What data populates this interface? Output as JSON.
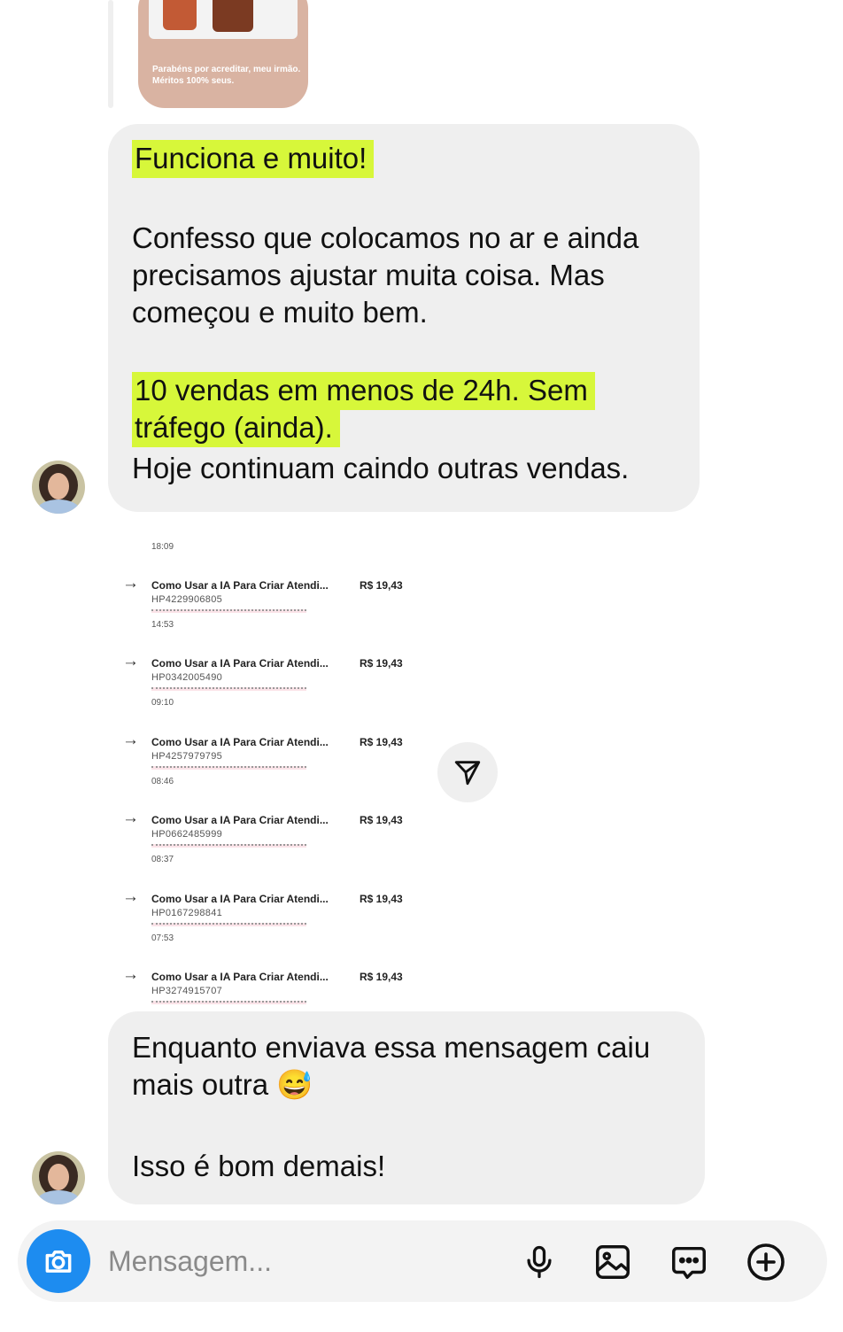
{
  "story_reply": {
    "caption": "Parabéns por acreditar, meu irmão. Méritos 100% seus."
  },
  "messages": [
    {
      "highlight_1": "Funciona e muito!",
      "paragraph": "Confesso que colocamos no ar e ainda precisamos ajustar muita coisa. Mas começou e muito bem.",
      "highlight_2": "10 vendas em menos de 24h. Sem tráfego (ainda).",
      "last_line": "Hoje continuam caindo outras vendas."
    },
    {
      "line_1": "Enquanto enviava essa mensagem caiu mais outra",
      "emoji": "😅",
      "line_2": "Isso é bom demais!"
    }
  ],
  "sales_screenshot": {
    "times": [
      "18:09",
      "14:53",
      "09:10",
      "08:46",
      "08:37",
      "07:53"
    ],
    "rows": [
      {
        "product": "Como Usar a IA Para Criar Atendi...",
        "price": "R$ 19,43",
        "code": "HP4229906805"
      },
      {
        "product": "Como Usar a IA Para Criar Atendi...",
        "price": "R$ 19,43",
        "code": "HP0342005490"
      },
      {
        "product": "Como Usar a IA Para Criar Atendi...",
        "price": "R$ 19,43",
        "code": "HP4257979795"
      },
      {
        "product": "Como Usar a IA Para Criar Atendi...",
        "price": "R$ 19,43",
        "code": "HP0662485999"
      },
      {
        "product": "Como Usar a IA Para Criar Atendi...",
        "price": "R$ 19,43",
        "code": "HP0167298841"
      },
      {
        "product": "Como Usar a IA Para Criar Atendi...",
        "price": "R$ 19,43",
        "code": "HP3274915707"
      }
    ]
  },
  "composer": {
    "placeholder": "Mensagem...",
    "accent": "#1d8cf0",
    "icons": [
      "camera-icon",
      "microphone-icon",
      "gallery-icon",
      "sticker-icon",
      "plus-icon"
    ]
  },
  "colors": {
    "bubble": "#efefef",
    "highlight": "#d7f73a"
  }
}
